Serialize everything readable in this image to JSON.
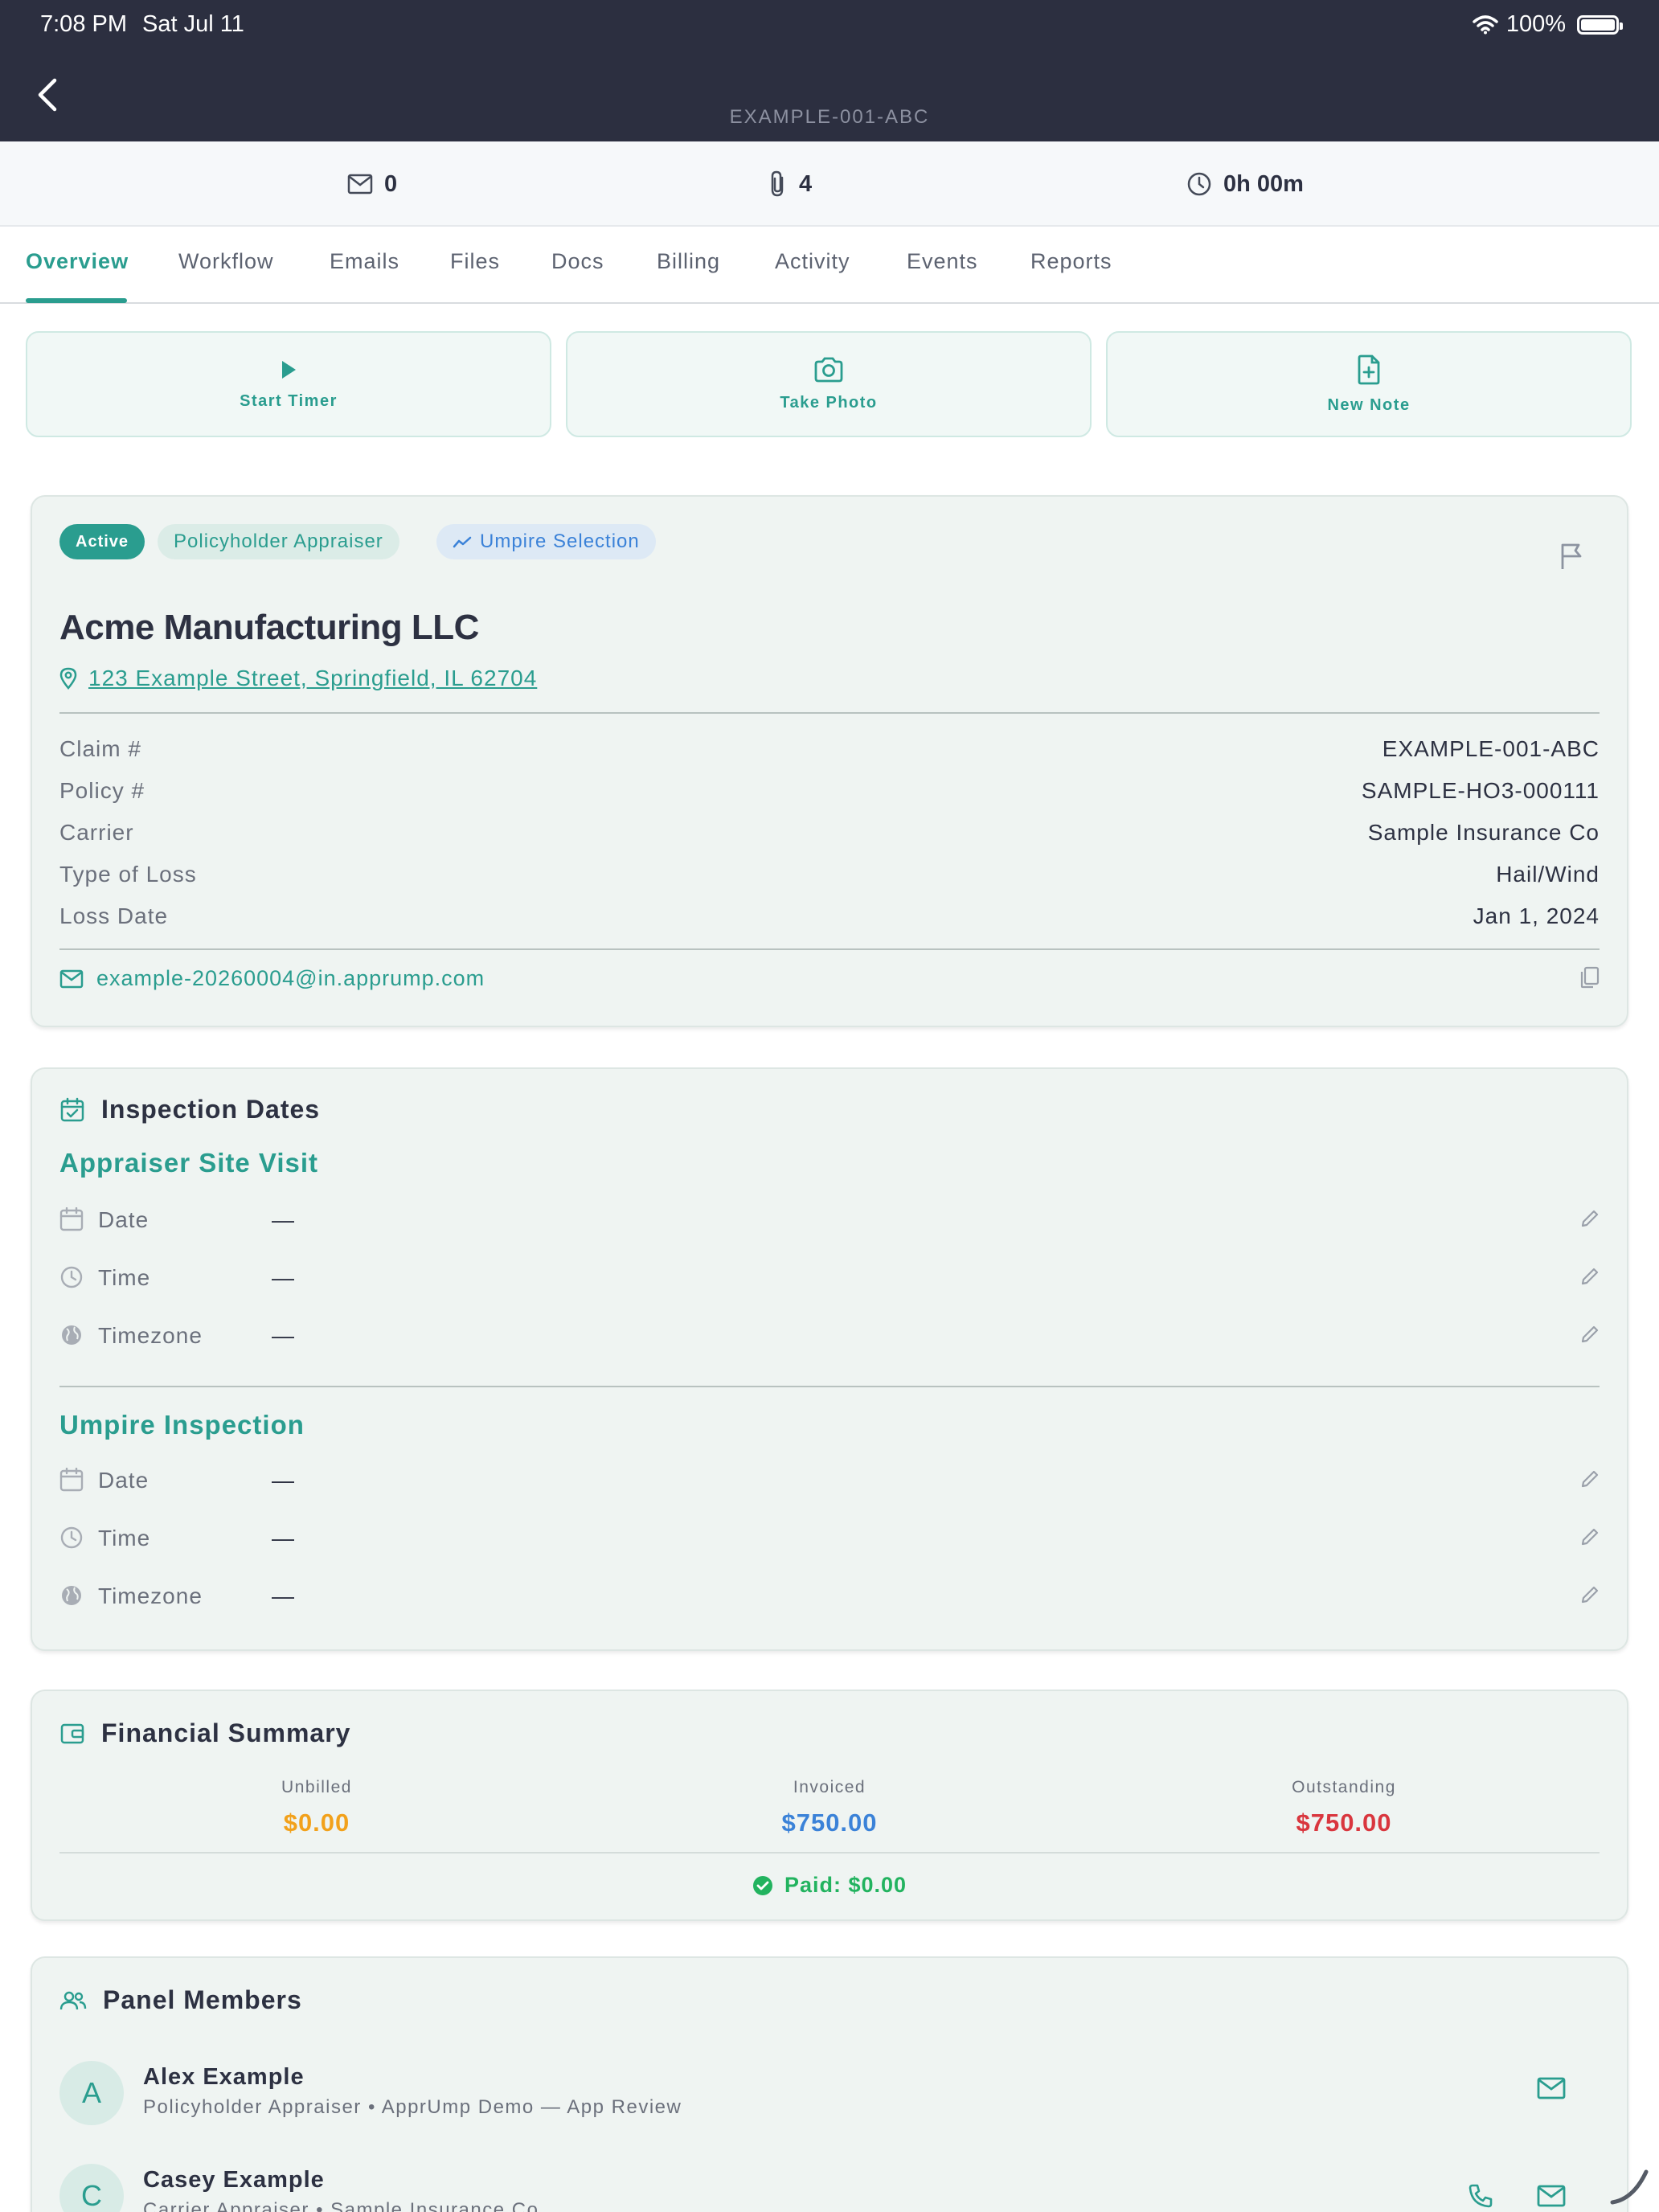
{
  "status_bar": {
    "time": "7:08 PM",
    "date": "Sat Jul 11",
    "battery": "100%"
  },
  "header": {
    "subtitle": "EXAMPLE-001-ABC"
  },
  "metrics": {
    "emails": "0",
    "attachments": "4",
    "time_logged": "0h 00m"
  },
  "tabs": [
    {
      "label": "Overview",
      "active": true
    },
    {
      "label": "Workflow"
    },
    {
      "label": "Emails"
    },
    {
      "label": "Files"
    },
    {
      "label": "Docs"
    },
    {
      "label": "Billing"
    },
    {
      "label": "Activity"
    },
    {
      "label": "Events"
    },
    {
      "label": "Reports"
    }
  ],
  "actions": {
    "start_timer": "Start Timer",
    "take_photo": "Take Photo",
    "new_note": "New Note"
  },
  "claim": {
    "status": "Active",
    "role": "Policyholder Appraiser",
    "stage": "Umpire Selection",
    "client_name": "Acme Manufacturing LLC",
    "address": "123 Example Street, Springfield, IL 62704",
    "fields": [
      {
        "label": "Claim #",
        "value": "EXAMPLE-001-ABC"
      },
      {
        "label": "Policy #",
        "value": "SAMPLE-HO3-000111"
      },
      {
        "label": "Carrier",
        "value": "Sample Insurance Co"
      },
      {
        "label": "Type of Loss",
        "value": "Hail/Wind"
      },
      {
        "label": "Loss Date",
        "value": "Jan 1, 2024"
      }
    ],
    "email": "example-20260004@in.apprump.com"
  },
  "inspection": {
    "title": "Inspection Dates",
    "site_visit": {
      "title": "Appraiser Site Visit",
      "date_label": "Date",
      "date_value": "—",
      "time_label": "Time",
      "time_value": "—",
      "tz_label": "Timezone",
      "tz_value": "—"
    },
    "umpire": {
      "title": "Umpire Inspection",
      "date_label": "Date",
      "date_value": "—",
      "time_label": "Time",
      "time_value": "—",
      "tz_label": "Timezone",
      "tz_value": "—"
    }
  },
  "financial": {
    "title": "Financial Summary",
    "unbilled_label": "Unbilled",
    "unbilled_value": "$0.00",
    "invoiced_label": "Invoiced",
    "invoiced_value": "$750.00",
    "outstanding_label": "Outstanding",
    "outstanding_value": "$750.00",
    "paid": "Paid: $0.00",
    "colors": {
      "unbilled": "#f2a11b",
      "invoiced": "#3b82d8",
      "outstanding": "#d9363e",
      "paid": "#22b35f"
    }
  },
  "panel": {
    "title": "Panel Members",
    "members": [
      {
        "initial": "A",
        "name": "Alex Example",
        "subtitle": "Policyholder Appraiser • ApprUmp Demo — App Review"
      },
      {
        "initial": "C",
        "name": "Casey Example",
        "subtitle": "Carrier Appraiser • Sample Insurance Co"
      }
    ]
  },
  "icons": [
    "back-chevron-icon",
    "wifi-icon",
    "battery-icon",
    "mail-icon",
    "paperclip-icon",
    "clock-icon",
    "play-icon",
    "camera-icon",
    "file-plus-icon",
    "trend-icon",
    "flag-icon",
    "map-pin-icon",
    "copy-icon",
    "calendar-check-icon",
    "calendar-icon",
    "globe-icon",
    "pencil-icon",
    "wallet-icon",
    "check-circle-icon",
    "users-icon",
    "phone-icon"
  ],
  "theme": {
    "accent": "#2a9d8f",
    "header_bg": "#2c2f40"
  }
}
